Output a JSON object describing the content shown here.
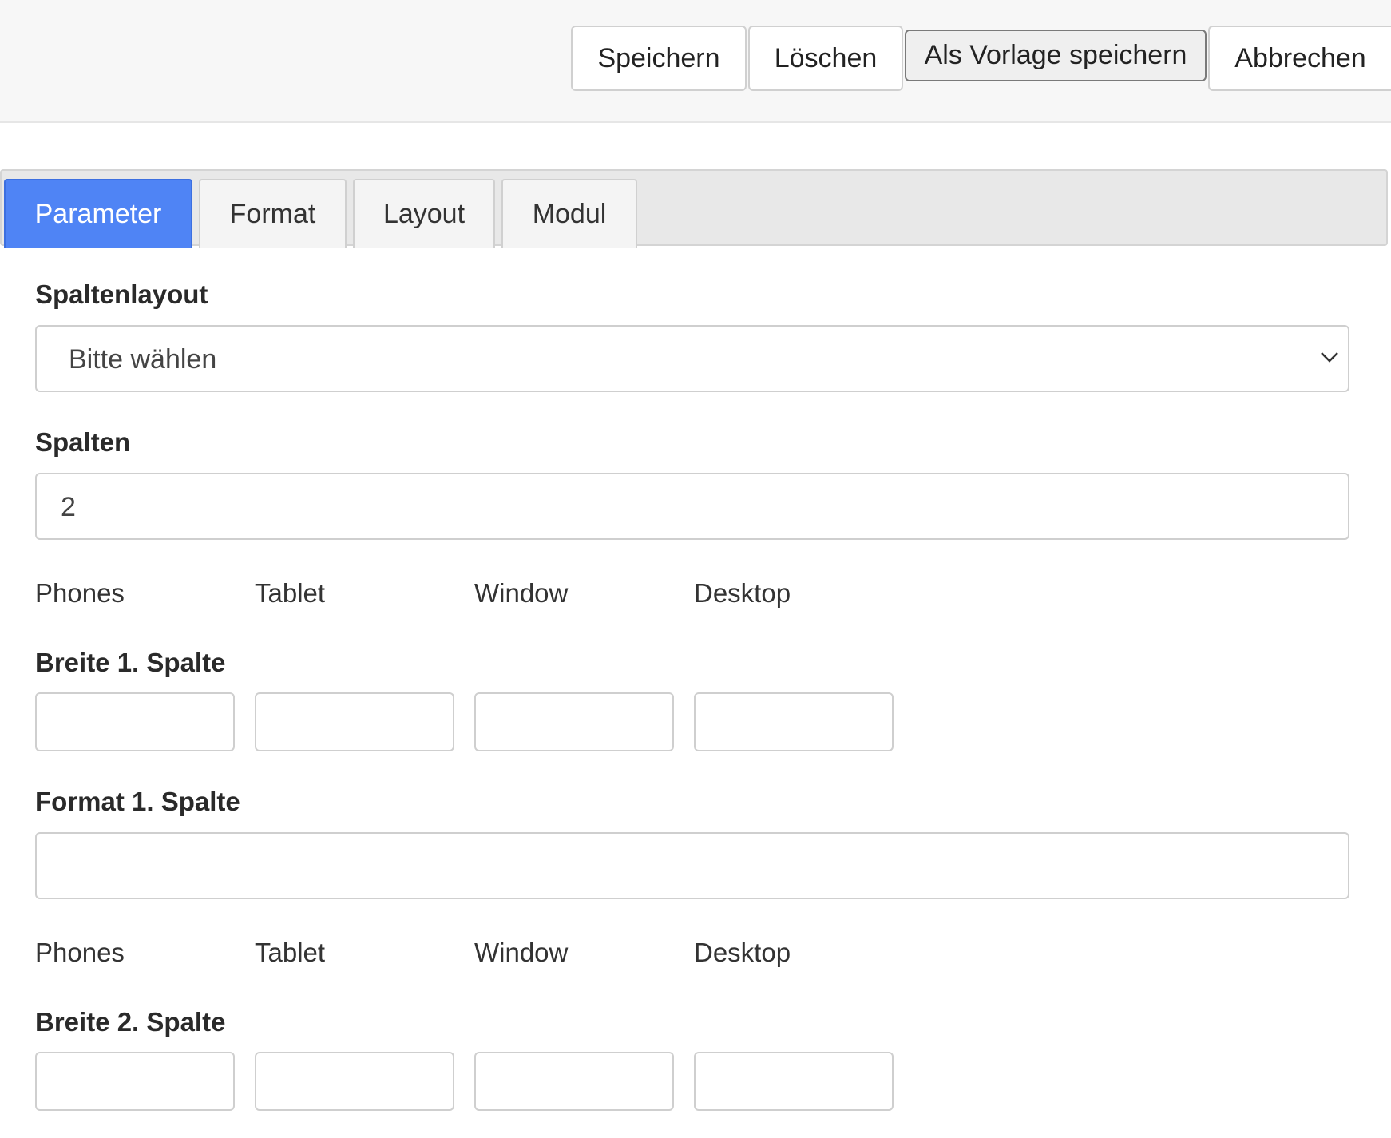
{
  "toolbar": {
    "save_label": "Speichern",
    "delete_label": "Löschen",
    "save_template_label": "Als Vorlage speichern",
    "cancel_label": "Abbrechen"
  },
  "tabs": [
    {
      "label": "Parameter",
      "active": true
    },
    {
      "label": "Format",
      "active": false
    },
    {
      "label": "Layout",
      "active": false
    },
    {
      "label": "Modul",
      "active": false
    }
  ],
  "form": {
    "column_layout": {
      "label": "Spaltenlayout",
      "selected": "Bitte wählen",
      "icon": "chevron-down-icon"
    },
    "columns": {
      "label": "Spalten",
      "value": "2"
    },
    "devices": [
      "Phones",
      "Tablet",
      "Window",
      "Desktop"
    ],
    "width_col1": {
      "label": "Breite 1. Spalte"
    },
    "format_col1": {
      "label": "Format 1. Spalte",
      "value": ""
    },
    "width_col2": {
      "label": "Breite 2. Spalte"
    }
  },
  "colors": {
    "accent": "#4f84f5",
    "toolbar_bg": "#f7f7f7",
    "tabbar_bg": "#e8e8e8"
  }
}
